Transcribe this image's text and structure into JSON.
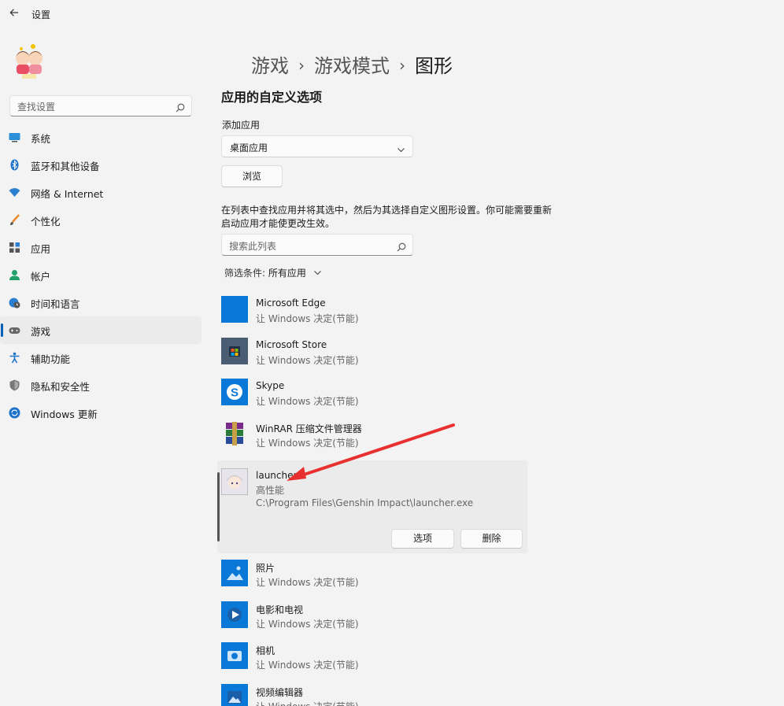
{
  "window": {
    "title": "设置",
    "back_icon": "back-arrow-icon"
  },
  "sidebar": {
    "search_placeholder": "查找设置",
    "items": [
      {
        "label": "系统",
        "icon": "monitor-icon",
        "active": false
      },
      {
        "label": "蓝牙和其他设备",
        "icon": "bluetooth-icon",
        "active": false
      },
      {
        "label": "网络 & Internet",
        "icon": "wifi-icon",
        "active": false
      },
      {
        "label": "个性化",
        "icon": "brush-icon",
        "active": false
      },
      {
        "label": "应用",
        "icon": "apps-icon",
        "active": false
      },
      {
        "label": "帐户",
        "icon": "person-icon",
        "active": false
      },
      {
        "label": "时间和语言",
        "icon": "globe-clock-icon",
        "active": false
      },
      {
        "label": "游戏",
        "icon": "gamepad-icon",
        "active": true
      },
      {
        "label": "辅助功能",
        "icon": "accessibility-icon",
        "active": false
      },
      {
        "label": "隐私和安全性",
        "icon": "shield-icon",
        "active": false
      },
      {
        "label": "Windows 更新",
        "icon": "update-icon",
        "active": false
      }
    ]
  },
  "breadcrumb": {
    "part1": "游戏",
    "part2": "游戏模式",
    "part3": "图形",
    "separator": "›"
  },
  "main": {
    "section_title": "应用的自定义选项",
    "add_app_label": "添加应用",
    "dropdown_value": "桌面应用",
    "browse_label": "浏览",
    "description": "在列表中查找应用并将其选中，然后为其选择自定义图形设置。你可能需要重新启动应用才能使更改生效。",
    "search_placeholder": "搜索此列表",
    "filter_label": "筛选条件:",
    "filter_value": "所有应用"
  },
  "apps": [
    {
      "name": "Microsoft Edge",
      "setting": "让 Windows 决定(节能)",
      "icon": "edge-icon"
    },
    {
      "name": "Microsoft Store",
      "setting": "让 Windows 决定(节能)",
      "icon": "store-icon"
    },
    {
      "name": "Skype",
      "setting": "让 Windows 决定(节能)",
      "icon": "skype-icon"
    },
    {
      "name": "WinRAR 压缩文件管理器",
      "setting": "让 Windows 决定(节能)",
      "icon": "winrar-icon"
    },
    {
      "name": "launcher",
      "setting": "高性能",
      "path": "C:\\Program Files\\Genshin Impact\\launcher.exe",
      "icon": "launcher-icon",
      "expanded": true,
      "options_label": "选项",
      "delete_label": "删除"
    },
    {
      "name": "照片",
      "setting": "让 Windows 决定(节能)",
      "icon": "photos-icon"
    },
    {
      "name": "电影和电视",
      "setting": "让 Windows 决定(节能)",
      "icon": "movies-icon"
    },
    {
      "name": "相机",
      "setting": "让 Windows 决定(节能)",
      "icon": "camera-icon"
    },
    {
      "name": "视频编辑器",
      "setting": "让 Windows 决定(节能)",
      "icon": "video-editor-icon"
    }
  ],
  "colors": {
    "accent": "#005fb8",
    "annotation_arrow": "#e8302f",
    "tile_blue": "#0a78d7"
  }
}
